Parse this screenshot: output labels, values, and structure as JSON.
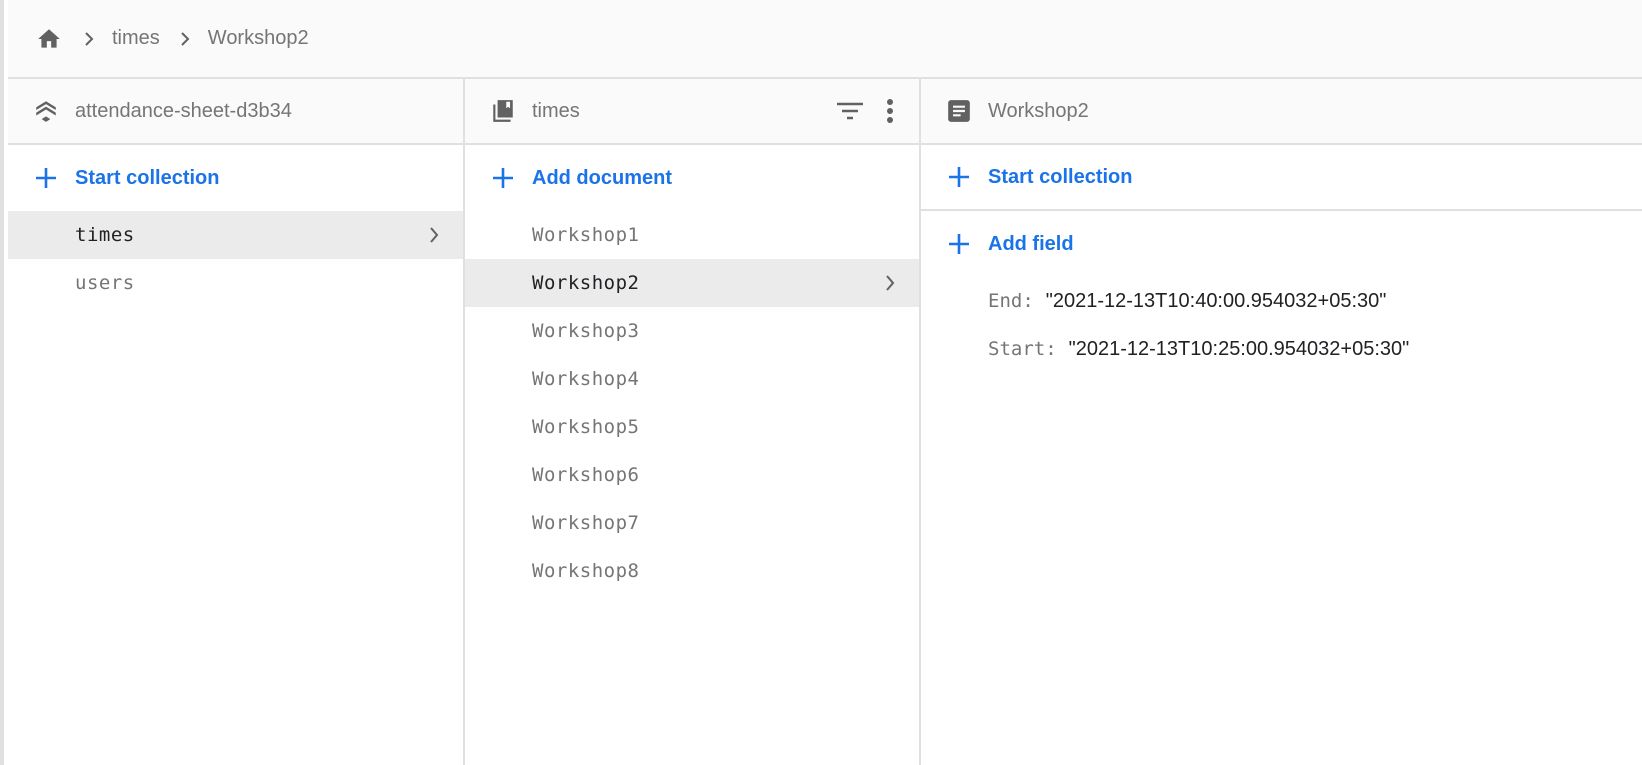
{
  "breadcrumb": {
    "home_icon": "home-icon",
    "separator_icon": "chevron-right-icon",
    "items": [
      "times",
      "Workshop2"
    ]
  },
  "colors": {
    "accent": "#1a73e8",
    "selected_row": "#ebebeb",
    "header_bg": "#fafafa",
    "muted_text": "#757575",
    "primary_text": "#202124"
  },
  "columns": {
    "root": {
      "icon": "firestore-database-icon",
      "title": "attendance-sheet-d3b34",
      "add_label": "Start collection",
      "items": [
        {
          "label": "times",
          "selected": true
        },
        {
          "label": "users",
          "selected": false
        }
      ]
    },
    "collection": {
      "icon": "collection-icon",
      "title": "times",
      "filter_icon": "filter-icon",
      "more_icon": "more-vert-icon",
      "add_label": "Add document",
      "items": [
        {
          "label": "Workshop1",
          "selected": false
        },
        {
          "label": "Workshop2",
          "selected": true
        },
        {
          "label": "Workshop3",
          "selected": false
        },
        {
          "label": "Workshop4",
          "selected": false
        },
        {
          "label": "Workshop5",
          "selected": false
        },
        {
          "label": "Workshop6",
          "selected": false
        },
        {
          "label": "Workshop7",
          "selected": false
        },
        {
          "label": "Workshop8",
          "selected": false
        }
      ]
    },
    "document": {
      "icon": "document-icon",
      "title": "Workshop2",
      "add_collection_label": "Start collection",
      "add_field_label": "Add field",
      "fields": [
        {
          "key": "End:",
          "value": "\"2021-12-13T10:40:00.954032+05:30\""
        },
        {
          "key": "Start:",
          "value": "\"2021-12-13T10:25:00.954032+05:30\""
        }
      ]
    }
  }
}
